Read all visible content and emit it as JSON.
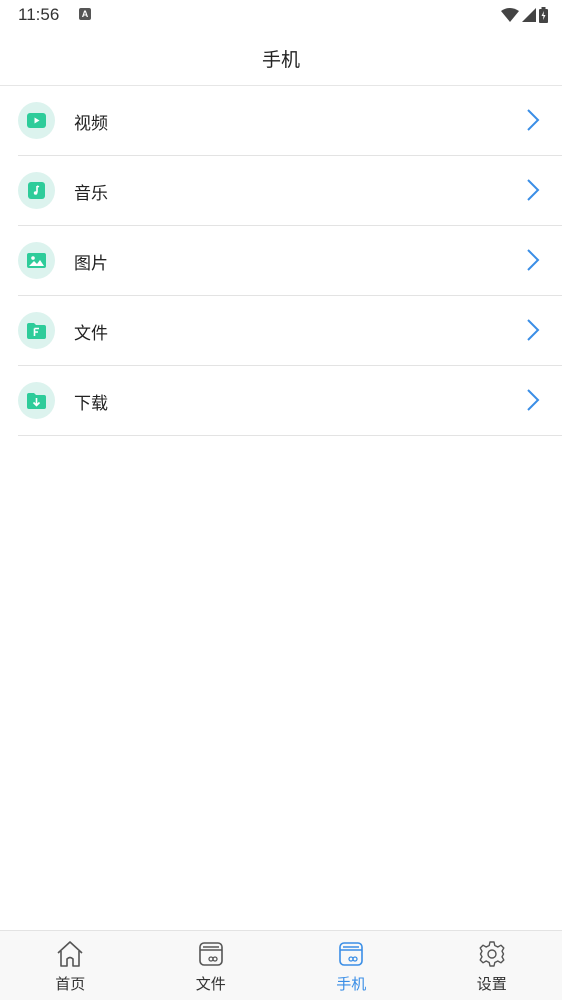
{
  "status_bar": {
    "time": "11:56",
    "notification_icon": "a-icon",
    "right_icons": [
      "wifi-icon",
      "signal-icon",
      "battery-charging-icon"
    ]
  },
  "header": {
    "title": "手机"
  },
  "list": {
    "items": [
      {
        "label": "视频",
        "icon": "video-icon"
      },
      {
        "label": "音乐",
        "icon": "music-icon"
      },
      {
        "label": "图片",
        "icon": "image-icon"
      },
      {
        "label": "文件",
        "icon": "file-icon"
      },
      {
        "label": "下载",
        "icon": "download-icon"
      }
    ]
  },
  "bottom_nav": {
    "tabs": [
      {
        "label": "首页",
        "icon": "home-icon",
        "active": false
      },
      {
        "label": "文件",
        "icon": "files-icon",
        "active": false
      },
      {
        "label": "手机",
        "icon": "phone-storage-icon",
        "active": true
      },
      {
        "label": "设置",
        "icon": "gear-icon",
        "active": false
      }
    ]
  },
  "colors": {
    "accent": "#3a8ee6",
    "icon_green": "#2ecc9a",
    "icon_bg": "#dcf3ee",
    "chevron": "#3a8ee6"
  }
}
